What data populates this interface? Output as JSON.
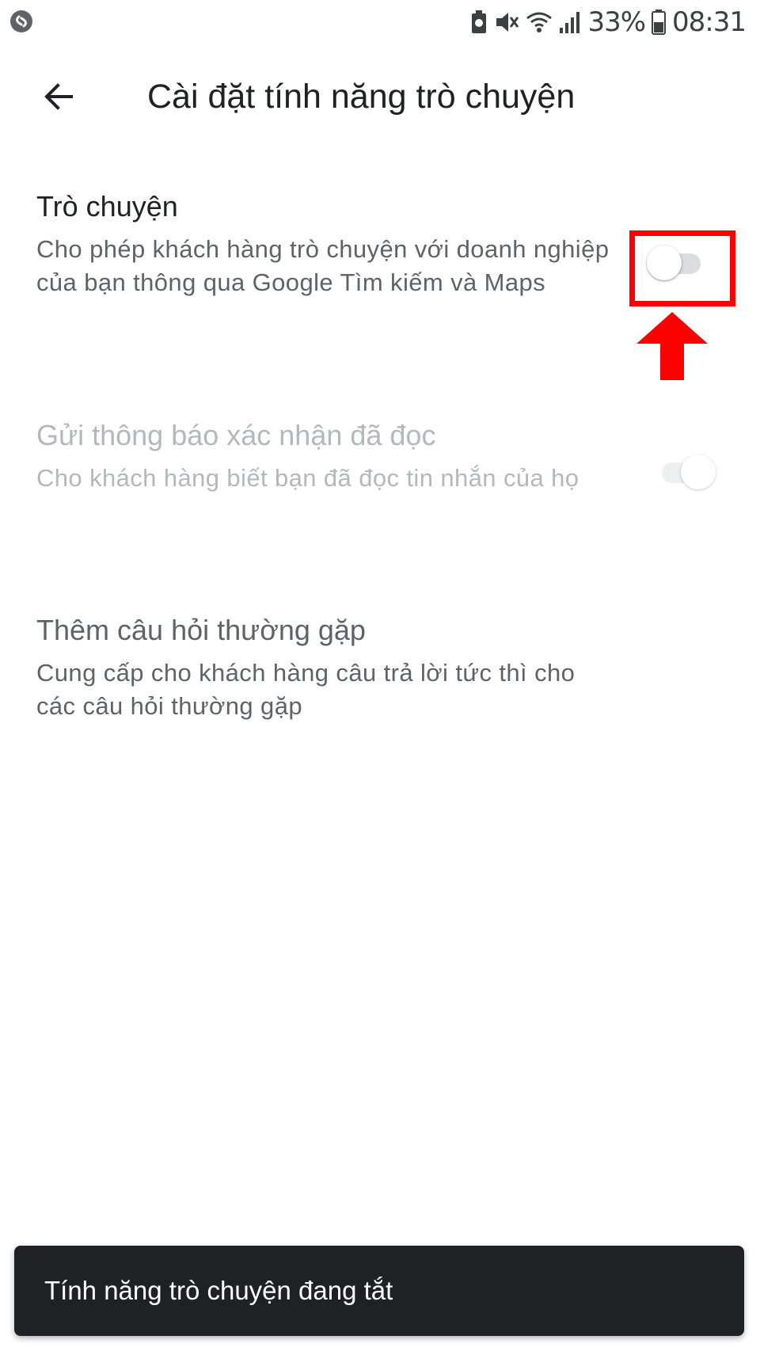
{
  "status_bar": {
    "app_icon": "shazam-icon",
    "battery_percent": "33%",
    "time": "08:31",
    "icons": [
      "battery-saver-icon",
      "mute-icon",
      "wifi-icon",
      "signal-icon",
      "battery-icon"
    ]
  },
  "app_bar": {
    "back_icon": "arrow-back-icon",
    "title": "Cài đặt tính năng trò chuyện"
  },
  "settings": [
    {
      "title": "Trò chuyện",
      "description": "Cho phép khách hàng trò chuyện với doanh nghiệp của bạn thông qua Google Tìm kiếm và Maps",
      "toggle": "off",
      "enabled": true
    },
    {
      "title": "Gửi thông báo xác nhận đã đọc",
      "description": "Cho khách hàng biết bạn đã đọc tin nhắn của họ",
      "toggle": "on",
      "enabled": false
    },
    {
      "title": "Thêm câu hỏi thường gặp",
      "description": "Cung cấp cho khách hàng câu trả lời tức thì cho các câu hỏi thường gặp"
    }
  ],
  "annotation": {
    "color": "#ff0000",
    "shapes": [
      "highlight-box",
      "up-arrow"
    ]
  },
  "snackbar": {
    "text": "Tính năng trò chuyện đang tắt"
  },
  "colors": {
    "title_text": "#202124",
    "secondary_text": "#5f6368",
    "disabled_text": "#b4b7bb",
    "snackbar_bg": "#202124",
    "annotation_red": "#ff0000"
  }
}
